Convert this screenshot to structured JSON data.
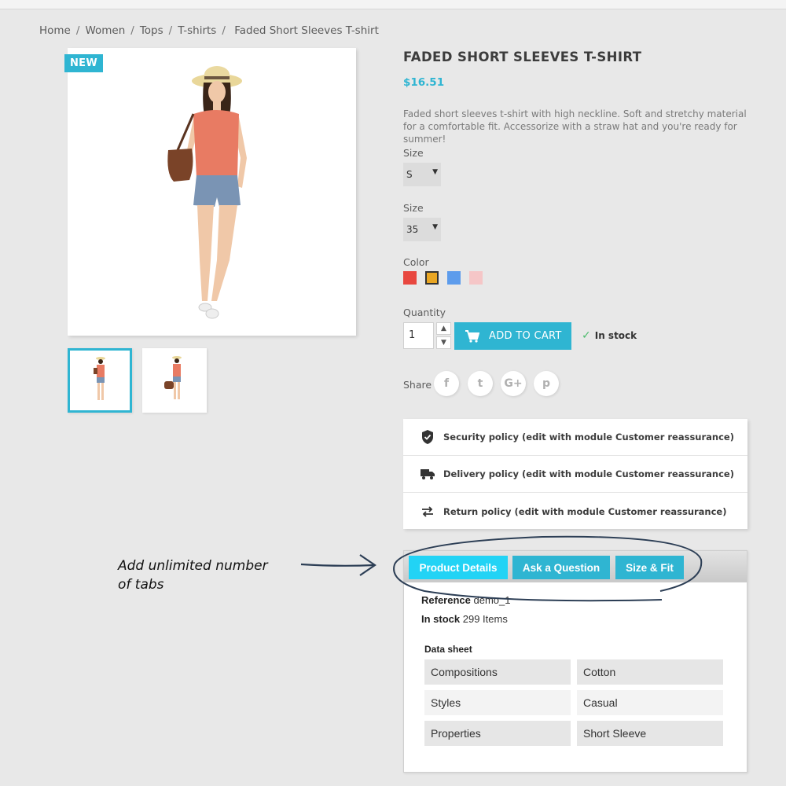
{
  "breadcrumb": [
    "Home",
    "Women",
    "Tops",
    "T-shirts",
    "Faded Short Sleeves T-shirt"
  ],
  "gallery": {
    "badge": "NEW"
  },
  "product": {
    "title": "FADED SHORT SLEEVES T-SHIRT",
    "price": "$16.51",
    "description": "Faded short sleeves t-shirt with high neckline. Soft and stretchy material for a comfortable fit. Accessorize with a straw hat and you're ready for summer!"
  },
  "variants": {
    "size1_label": "Size",
    "size1_value": "S",
    "size2_label": "Size",
    "size2_value": "35",
    "color_label": "Color",
    "colors": [
      "#e8473f",
      "#e9a623",
      "#5d9cec",
      "#f5c6c7"
    ]
  },
  "cart": {
    "quantity_label": "Quantity",
    "quantity_value": "1",
    "add_label": "ADD TO CART",
    "stock_label": "In stock"
  },
  "share": {
    "label": "Share",
    "networks": [
      "f",
      "t",
      "G+",
      "p"
    ]
  },
  "reassurance": [
    {
      "icon": "shield-icon",
      "text": "Security policy (edit with module Customer reassurance)"
    },
    {
      "icon": "truck-icon",
      "text": "Delivery policy (edit with module Customer reassurance)"
    },
    {
      "icon": "swap-arrows-icon",
      "text": "Return policy (edit with module Customer reassurance)"
    }
  ],
  "annotation": {
    "line1": "Add unlimited number",
    "line2": "of tabs"
  },
  "tabs": {
    "items": [
      "Product Details",
      "Ask a Question",
      "Size & Fit"
    ],
    "reference_label": "Reference",
    "reference_value": "demo_1",
    "stock_label": "In stock",
    "stock_value": "299 Items",
    "datasheet_title": "Data sheet",
    "datasheet": [
      [
        "Compositions",
        "Cotton"
      ],
      [
        "Styles",
        "Casual"
      ],
      [
        "Properties",
        "Short Sleeve"
      ]
    ]
  },
  "colors": {
    "accent": "#2fb5d2",
    "active_tab": "#22d3f5",
    "background": "#e8e8e8"
  }
}
